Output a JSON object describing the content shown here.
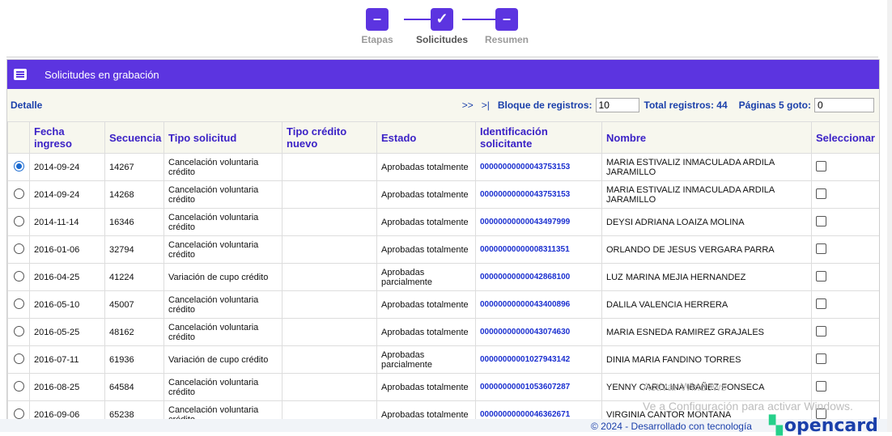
{
  "stepper": [
    {
      "label": "Etapas",
      "symbol": "–",
      "active": false
    },
    {
      "label": "Solicitudes",
      "symbol": "✓",
      "active": true
    },
    {
      "label": "Resumen",
      "symbol": "–",
      "active": false
    }
  ],
  "panel": {
    "title": "Solicitudes en grabación",
    "detalle_label": "Detalle",
    "next_label": ">>",
    "last_label": ">|",
    "bloque_label": "Bloque de registros:",
    "bloque_value": "10",
    "total_label": "Total registros: 44",
    "paginas_label": "Páginas 5 goto:",
    "goto_value": "0"
  },
  "table": {
    "headers": [
      "Fecha ingreso",
      "Secuencia",
      "Tipo solicitud",
      "Tipo crédito nuevo",
      "Estado",
      "Identificación solicitante",
      "Nombre",
      "Seleccionar"
    ],
    "rows": [
      {
        "fecha": "2014-09-24",
        "secuencia": "14267",
        "tipo": "Cancelación voluntaria crédito",
        "tipo_nuevo": "",
        "estado": "Aprobadas totalmente",
        "id": "00000000000043753153",
        "nombre": "MARIA ESTIVALIZ INMACULADA ARDILA JARAMILLO",
        "selected": true
      },
      {
        "fecha": "2014-09-24",
        "secuencia": "14268",
        "tipo": "Cancelación voluntaria crédito",
        "tipo_nuevo": "",
        "estado": "Aprobadas totalmente",
        "id": "00000000000043753153",
        "nombre": "MARIA ESTIVALIZ INMACULADA ARDILA JARAMILLO",
        "selected": false
      },
      {
        "fecha": "2014-11-14",
        "secuencia": "16346",
        "tipo": "Cancelación voluntaria crédito",
        "tipo_nuevo": "",
        "estado": "Aprobadas totalmente",
        "id": "00000000000043497999",
        "nombre": "DEYSI ADRIANA LOAIZA MOLINA",
        "selected": false
      },
      {
        "fecha": "2016-01-06",
        "secuencia": "32794",
        "tipo": "Cancelación voluntaria crédito",
        "tipo_nuevo": "",
        "estado": "Aprobadas totalmente",
        "id": "00000000000008311351",
        "nombre": "ORLANDO DE JESUS VERGARA PARRA",
        "selected": false
      },
      {
        "fecha": "2016-04-25",
        "secuencia": "41224",
        "tipo": "Variación de cupo crédito",
        "tipo_nuevo": "",
        "estado": "Aprobadas parcialmente",
        "id": "00000000000042868100",
        "nombre": "LUZ MARINA MEJIA HERNANDEZ",
        "selected": false
      },
      {
        "fecha": "2016-05-10",
        "secuencia": "45007",
        "tipo": "Cancelación voluntaria crédito",
        "tipo_nuevo": "",
        "estado": "Aprobadas totalmente",
        "id": "00000000000043400896",
        "nombre": "DALILA VALENCIA HERRERA",
        "selected": false
      },
      {
        "fecha": "2016-05-25",
        "secuencia": "48162",
        "tipo": "Cancelación voluntaria crédito",
        "tipo_nuevo": "",
        "estado": "Aprobadas totalmente",
        "id": "00000000000043074630",
        "nombre": "MARIA ESNEDA RAMIREZ GRAJALES",
        "selected": false
      },
      {
        "fecha": "2016-07-11",
        "secuencia": "61936",
        "tipo": "Variación de cupo crédito",
        "tipo_nuevo": "",
        "estado": "Aprobadas parcialmente",
        "id": "00000000001027943142",
        "nombre": "DINIA MARIA FANDINO TORRES",
        "selected": false
      },
      {
        "fecha": "2016-08-25",
        "secuencia": "64584",
        "tipo": "Cancelación voluntaria crédito",
        "tipo_nuevo": "",
        "estado": "Aprobadas totalmente",
        "id": "00000000001053607287",
        "nombre": "YENNY CAROLINA IBAÑEZ FONSECA",
        "selected": false
      },
      {
        "fecha": "2016-09-06",
        "secuencia": "65238",
        "tipo": "Cancelación voluntaria crédito",
        "tipo_nuevo": "",
        "estado": "Aprobadas totalmente",
        "id": "00000000000046362671",
        "nombre": "VIRGINIA CANTOR MONTANA",
        "selected": false
      }
    ]
  },
  "watermark": {
    "line1": "Activar Windows",
    "line2": "Ve a Configuración para activar Windows."
  },
  "footer": {
    "text": "© 2024 - Desarrollado con tecnología",
    "logo": "opencard"
  },
  "colors": {
    "primary": "#5c34e0",
    "link": "#1a3faa",
    "header_bg": "#f7f7ee"
  }
}
